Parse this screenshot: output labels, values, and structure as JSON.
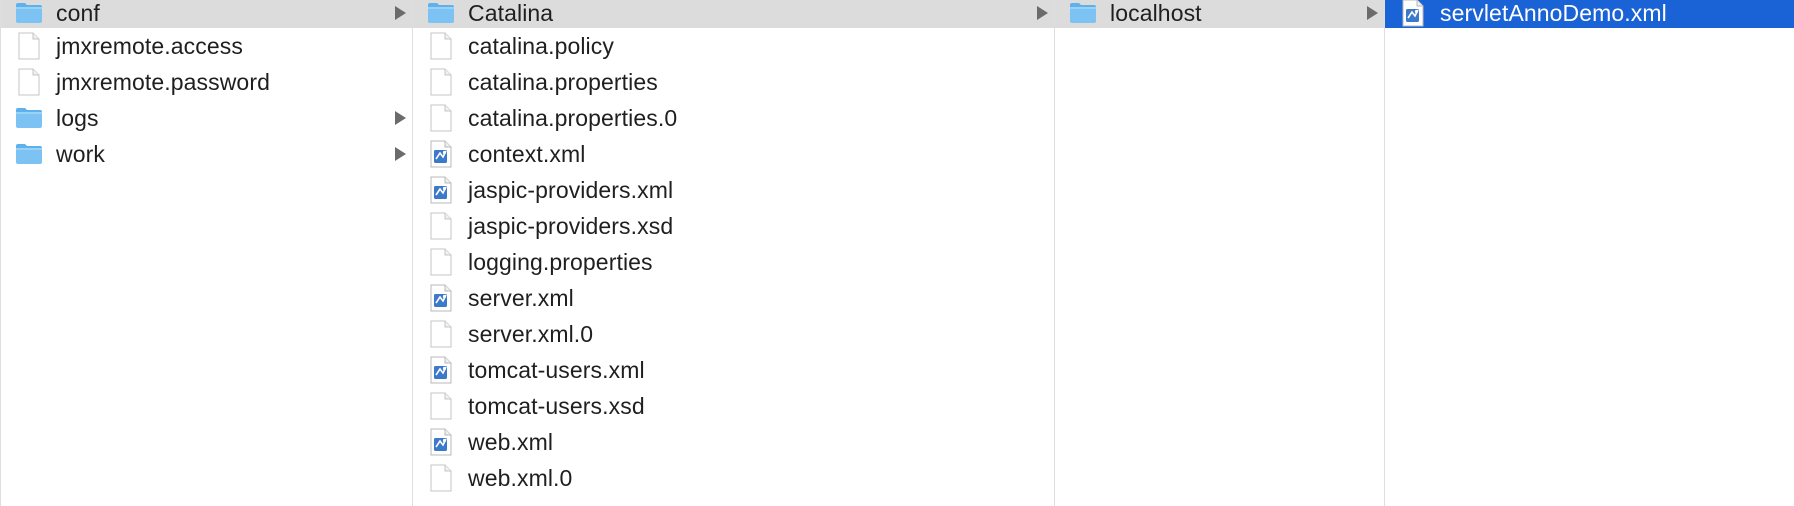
{
  "colors": {
    "selection": "#1a63d6",
    "path_highlight": "#dcdcdc",
    "folder": "#7cc3f3",
    "text": "#1f1f1f"
  },
  "columns": [
    {
      "items": [
        {
          "label": "conf",
          "icon": "folder-icon",
          "has_children": true,
          "state": "path"
        },
        {
          "label": "jmxremote.access",
          "icon": "document-icon",
          "has_children": false,
          "state": "none"
        },
        {
          "label": "jmxremote.password",
          "icon": "document-icon",
          "has_children": false,
          "state": "none"
        },
        {
          "label": "logs",
          "icon": "folder-icon",
          "has_children": true,
          "state": "none"
        },
        {
          "label": "work",
          "icon": "folder-icon",
          "has_children": true,
          "state": "none"
        }
      ]
    },
    {
      "items": [
        {
          "label": "Catalina",
          "icon": "folder-icon",
          "has_children": true,
          "state": "path"
        },
        {
          "label": "catalina.policy",
          "icon": "document-icon",
          "has_children": false,
          "state": "none"
        },
        {
          "label": "catalina.properties",
          "icon": "document-icon",
          "has_children": false,
          "state": "none"
        },
        {
          "label": "catalina.properties.0",
          "icon": "document-icon",
          "has_children": false,
          "state": "none"
        },
        {
          "label": "context.xml",
          "icon": "xml-file-icon",
          "has_children": false,
          "state": "none"
        },
        {
          "label": "jaspic-providers.xml",
          "icon": "xml-file-icon",
          "has_children": false,
          "state": "none"
        },
        {
          "label": "jaspic-providers.xsd",
          "icon": "document-icon",
          "has_children": false,
          "state": "none"
        },
        {
          "label": "logging.properties",
          "icon": "document-icon",
          "has_children": false,
          "state": "none"
        },
        {
          "label": "server.xml",
          "icon": "xml-file-icon",
          "has_children": false,
          "state": "none"
        },
        {
          "label": "server.xml.0",
          "icon": "document-icon",
          "has_children": false,
          "state": "none"
        },
        {
          "label": "tomcat-users.xml",
          "icon": "xml-file-icon",
          "has_children": false,
          "state": "none"
        },
        {
          "label": "tomcat-users.xsd",
          "icon": "document-icon",
          "has_children": false,
          "state": "none"
        },
        {
          "label": "web.xml",
          "icon": "xml-file-icon",
          "has_children": false,
          "state": "none"
        },
        {
          "label": "web.xml.0",
          "icon": "document-icon",
          "has_children": false,
          "state": "none"
        }
      ]
    },
    {
      "items": [
        {
          "label": "localhost",
          "icon": "folder-icon",
          "has_children": true,
          "state": "path"
        }
      ]
    },
    {
      "items": [
        {
          "label": "servletAnnoDemo.xml",
          "icon": "xml-file-icon",
          "has_children": false,
          "state": "selected"
        }
      ]
    }
  ]
}
